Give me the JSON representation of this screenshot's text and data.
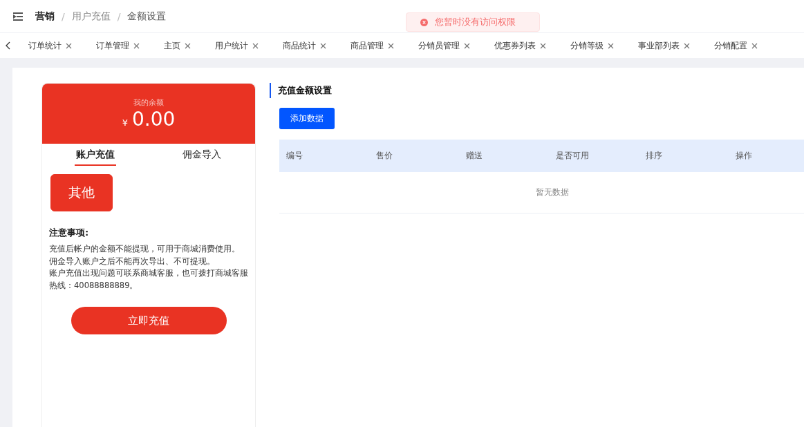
{
  "breadcrumb": [
    "营销",
    "用户充值",
    "金额设置"
  ],
  "breadcrumb_separator": "/",
  "toast": {
    "message": "您暂时没有访问权限"
  },
  "tabs": [
    {
      "label": "订单统计"
    },
    {
      "label": "订单管理"
    },
    {
      "label": "主页"
    },
    {
      "label": "用户统计"
    },
    {
      "label": "商品统计"
    },
    {
      "label": "商品管理"
    },
    {
      "label": "分销员管理"
    },
    {
      "label": "优惠券列表"
    },
    {
      "label": "分销等级"
    },
    {
      "label": "事业部列表"
    },
    {
      "label": "分销配置"
    }
  ],
  "wallet": {
    "balance_label": "我的余额",
    "currency": "¥",
    "balance": "0.00",
    "tabs": [
      {
        "label": "账户充值",
        "selected": true
      },
      {
        "label": "佣金导入",
        "selected": false
      }
    ],
    "options": [
      {
        "label": "其他",
        "selected": true
      }
    ],
    "notice_title": "注意事项:",
    "notice_lines": [
      "充值后帐户的金额不能提现，可用于商城消费使用。",
      "佣金导入账户之后不能再次导出、不可提现。",
      "账户充值出现问题可联系商城客服，也可拨打商城客服热线：40088888889。"
    ],
    "submit": "立即充值"
  },
  "section": {
    "title": "充值金额设置",
    "add_button": "添加数据",
    "table": {
      "columns": [
        "编号",
        "售价",
        "赠送",
        "是否可用",
        "排序",
        "操作"
      ],
      "empty_text": "暂无数据"
    }
  }
}
